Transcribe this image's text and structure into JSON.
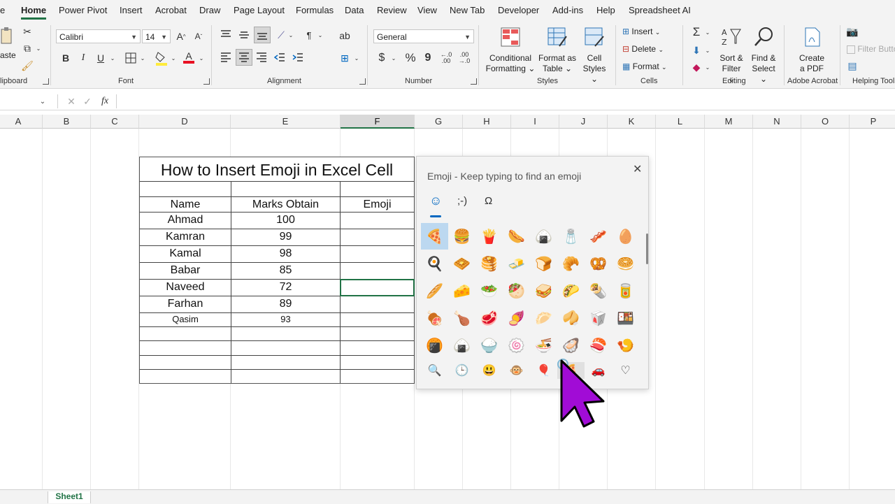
{
  "menu": {
    "tabs": [
      "e",
      "Home",
      "Power Pivot",
      "Insert",
      "Acrobat",
      "Draw",
      "Page Layout",
      "Formulas",
      "Data",
      "Review",
      "View",
      "New Tab",
      "Developer",
      "Add-ins",
      "Help",
      "Spreadsheet AI"
    ],
    "active_tab": "Home"
  },
  "ribbon": {
    "clipboard": {
      "paste_label": "aste",
      "group_label": "lipboard"
    },
    "font": {
      "name": "Calibri",
      "size": "14",
      "bold": "B",
      "italic": "I",
      "underline": "U",
      "group_label": "Font",
      "grow": "A",
      "shrink": "A",
      "font_color_letter": "A"
    },
    "alignment": {
      "group_label": "Alignment"
    },
    "number": {
      "format": "General",
      "currency": "$",
      "percent": "%",
      "comma": "9",
      "group_label": "Number"
    },
    "styles": {
      "conditional": "Conditional",
      "conditional2": "Formatting",
      "format_table": "Format as",
      "format_table2": "Table",
      "cell_styles": "Cell",
      "cell_styles2": "Styles",
      "group_label": "Styles"
    },
    "cells": {
      "insert": "Insert",
      "delete": "Delete",
      "format": "Format",
      "group_label": "Cells"
    },
    "editing": {
      "sort": "Sort &",
      "sort2": "Filter",
      "find": "Find &",
      "find2": "Select",
      "group_label": "Editing"
    },
    "acrobat": {
      "create": "Create",
      "create2": "a PDF",
      "group_label": "Adobe Acrobat"
    },
    "helping": {
      "filter_buttons": "Filter Butto",
      "group_label": "Helping Tools"
    }
  },
  "formula_bar": {
    "fx": "fx",
    "cancel": "✕",
    "enter": "✓",
    "value": ""
  },
  "columns": [
    "A",
    "B",
    "C",
    "D",
    "E",
    "F",
    "G",
    "H",
    "I",
    "J",
    "K",
    "L",
    "M",
    "N",
    "O",
    "P"
  ],
  "selected_column": "F",
  "table": {
    "title": "How to Insert Emoji in Excel Cell",
    "headers": [
      "Name",
      "Marks Obtain",
      "Emoji"
    ],
    "rows": [
      {
        "name": "Ahmad",
        "marks": "100"
      },
      {
        "name": "Kamran",
        "marks": "99"
      },
      {
        "name": "Kamal",
        "marks": "98"
      },
      {
        "name": "Babar",
        "marks": "85"
      },
      {
        "name": "Naveed",
        "marks": "72"
      },
      {
        "name": "Farhan",
        "marks": "89"
      },
      {
        "name": "Qasim",
        "marks": "93"
      }
    ]
  },
  "emoji_panel": {
    "title": "Emoji - Keep typing to find an emoji",
    "close": "✕",
    "tabs": [
      {
        "label": "☺",
        "icon": "smiley-icon"
      },
      {
        "label": ";-)",
        "icon": "kaomoji-icon"
      },
      {
        "label": "Ω",
        "icon": "symbols-icon"
      }
    ],
    "emojis": [
      [
        "🍕",
        "🍔",
        "🍟",
        "🌭",
        "🍙",
        "🧂",
        "🥓",
        "🥚"
      ],
      [
        "🍳",
        "🧇",
        "🥞",
        "🧈",
        "🍞",
        "🥐",
        "🥨",
        "🥯"
      ],
      [
        "🥖",
        "🧀",
        "🥗",
        "🥙",
        "🥪",
        "🌮",
        "🌯",
        "🥫"
      ],
      [
        "🍖",
        "🍗",
        "🥩",
        "🍠",
        "🥟",
        "🥠",
        "🥡",
        "🍱"
      ],
      [
        "🍘",
        "🍙",
        "🍚",
        "🍥",
        "🍜",
        "🦪",
        "🍣",
        "🍤"
      ]
    ],
    "categories": [
      "🔍",
      "🕒",
      "😃",
      "🐵",
      "🎈",
      "🍕",
      "🚗",
      "♡"
    ]
  },
  "sheets": {
    "active": "Sheet1"
  }
}
